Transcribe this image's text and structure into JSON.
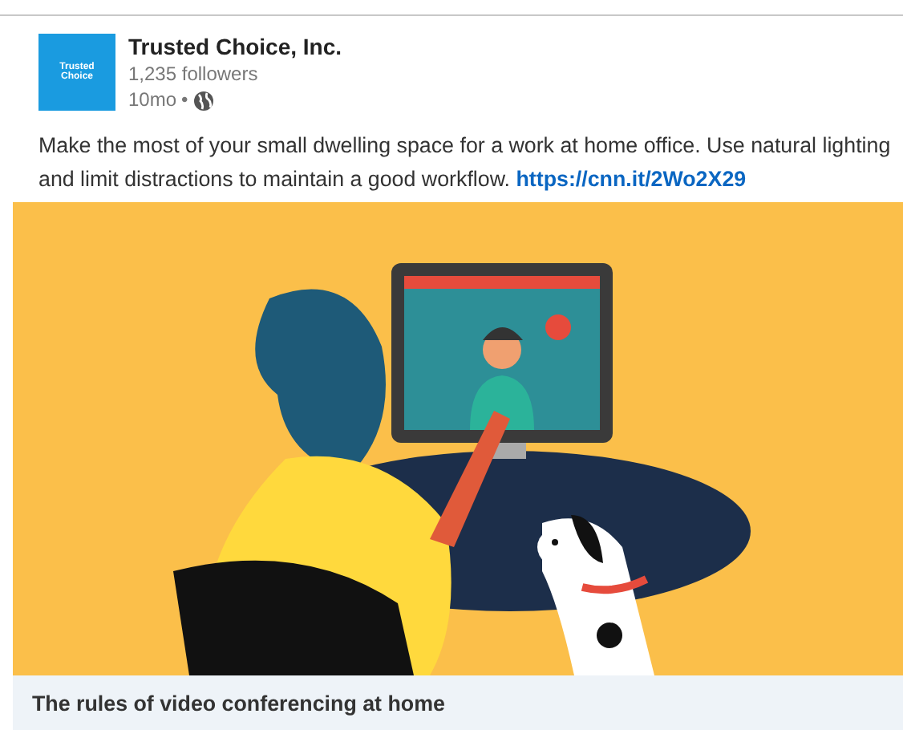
{
  "post": {
    "logo": {
      "lines": [
        "Trusted",
        "Choice"
      ]
    },
    "author": "Trusted Choice, Inc.",
    "followers": "1,235 followers",
    "age": "10mo",
    "separator": "•",
    "text": "Make the most of your small dwelling space for a work at home office. Use natural lighting and limit distractions to maintain a good workflow.",
    "link": "https://cnn.it/2Wo2X29",
    "article": {
      "title": "The rules of video conferencing at home"
    }
  }
}
